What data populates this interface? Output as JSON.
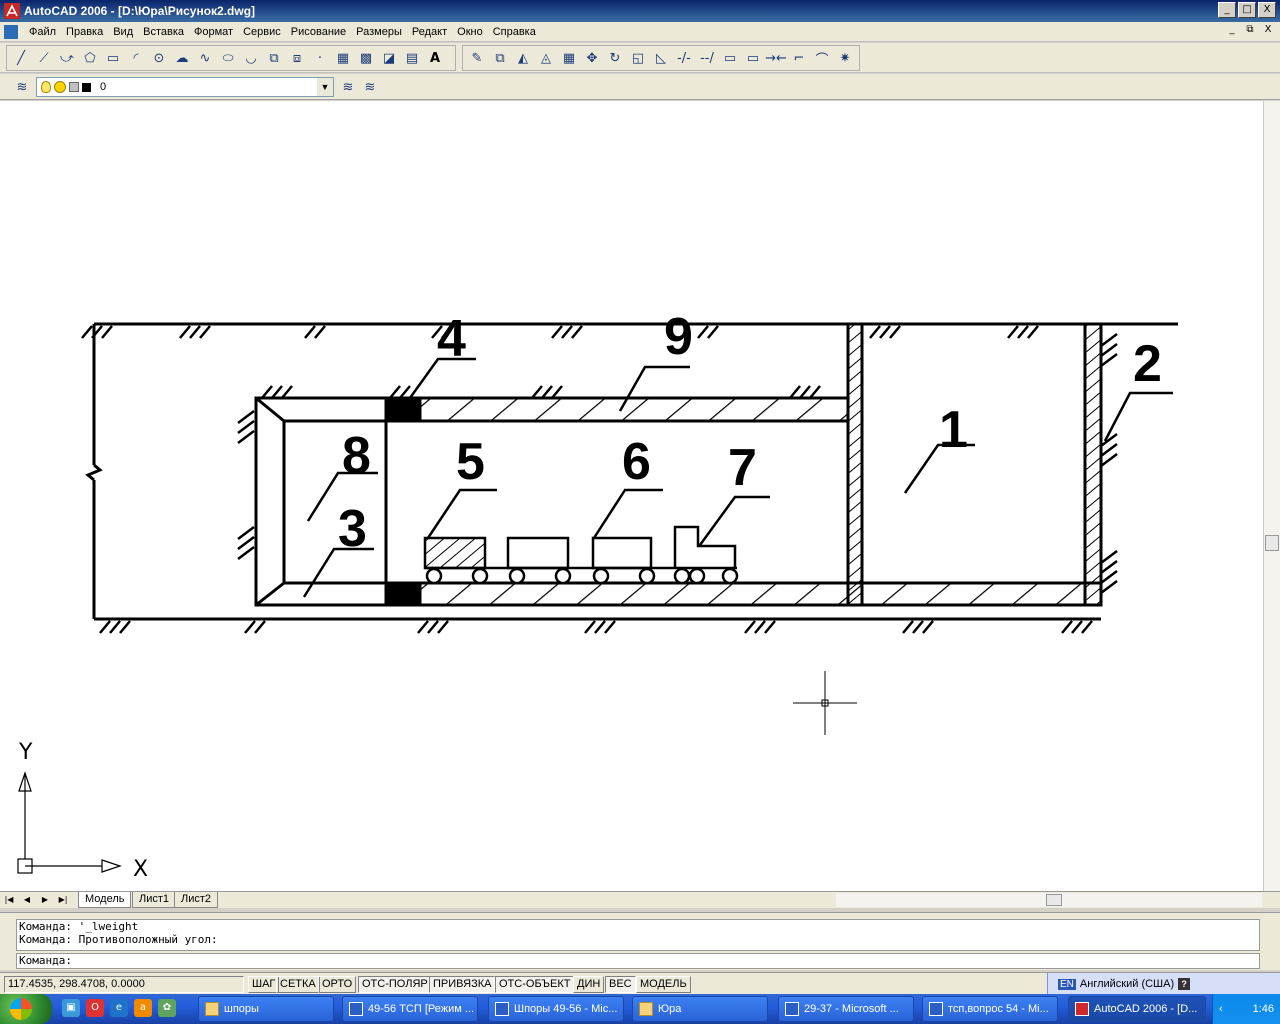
{
  "window": {
    "title": "AutoCAD 2006 - [D:\\Юра\\Рисунок2.dwg]",
    "controls": [
      "_",
      "□",
      "X"
    ]
  },
  "menu": {
    "items": [
      "Файл",
      "Правка",
      "Вид",
      "Вставка",
      "Формат",
      "Сервис",
      "Рисование",
      "Размеры",
      "Редакт",
      "Окно",
      "Справка"
    ],
    "doc_controls": [
      "_",
      "⧉",
      "X"
    ]
  },
  "draw_toolbar": {
    "icons": [
      "line-icon",
      "construction-line-icon",
      "polyline-icon",
      "polygon-icon",
      "rectangle-icon",
      "arc-icon",
      "circle-icon",
      "revision-cloud-icon",
      "spline-icon",
      "ellipse-icon",
      "ellipse-arc-icon",
      "insert-block-icon",
      "make-block-icon",
      "point-icon",
      "hatch-icon",
      "gradient-icon",
      "region-icon",
      "table-icon",
      "mtext-icon"
    ],
    "glyphs": [
      "╱",
      "⟋",
      "⤻",
      "⬠",
      "▭",
      "◜",
      "⊙",
      "☁",
      "∿",
      "⬭",
      "◡",
      "⧉",
      "⧈",
      "·",
      "▦",
      "▩",
      "◪",
      "▤",
      "A"
    ]
  },
  "modify_toolbar": {
    "icons": [
      "erase-icon",
      "copy-icon",
      "mirror-icon",
      "offset-icon",
      "array-icon",
      "move-icon",
      "rotate-icon",
      "scale-icon",
      "stretch-icon",
      "trim-icon",
      "extend-icon",
      "break-icon",
      "break-at-point-icon",
      "join-icon",
      "chamfer-icon",
      "fillet-icon",
      "explode-icon"
    ],
    "glyphs": [
      "✎",
      "⧉",
      "◭",
      "◬",
      "▦",
      "✥",
      "↻",
      "◱",
      "◺",
      "-/-",
      "--/",
      "▭",
      "▭",
      "→←",
      "⌐",
      "⌒",
      "✷"
    ]
  },
  "layers": {
    "current_layer": "0",
    "state_icons": [
      "lightbulb-icon",
      "sun-icon",
      "lock-icon",
      "color-swatch-icon"
    ]
  },
  "drawing": {
    "labels": [
      "1",
      "2",
      "3",
      "4",
      "5",
      "6",
      "7",
      "8",
      "9"
    ],
    "ucs": {
      "x_label": "X",
      "y_label": "Y"
    }
  },
  "layout_tabs": {
    "nav": [
      "|◀",
      "◀",
      "▶",
      "▶|"
    ],
    "tabs": [
      "Модель",
      "Лист1",
      "Лист2"
    ],
    "active": "Модель"
  },
  "command": {
    "history": [
      "Команда: '_lweight",
      "Команда: Противоположный угол:"
    ],
    "prompt": "Команда:"
  },
  "status": {
    "coordinates": "117.4535, 298.4708, 0.0000",
    "buttons": [
      "ШАГ",
      "СЕТКА",
      "ОРТО",
      "ОТС-ПОЛЯР",
      "ПРИВЯЗКА",
      "ОТС-ОБЪЕКТ",
      "ДИН",
      "ВЕС",
      "МОДЕЛЬ"
    ],
    "pressed": [
      "ОТС-ПОЛЯР",
      "ПРИВЯЗКА",
      "ОТС-ОБЪЕКТ",
      "ВЕС"
    ]
  },
  "language_bar": {
    "code": "EN",
    "language": "Английский (США)"
  },
  "taskbar": {
    "tasks": [
      "шпоры",
      "49-56 ТСП [Режим ...",
      "Шпоры 49-56 - Mic...",
      "Юра",
      "29-37 - Microsoft ...",
      "тсп,вопрос 54 - Mi...",
      "AutoCAD 2006 - [D..."
    ],
    "active_task": "AutoCAD 2006 - [D...",
    "clock": "1:46"
  },
  "colors": {
    "title_bar": "#0a246a",
    "canvas": "#ffffff",
    "taskbar": "#245edb"
  }
}
